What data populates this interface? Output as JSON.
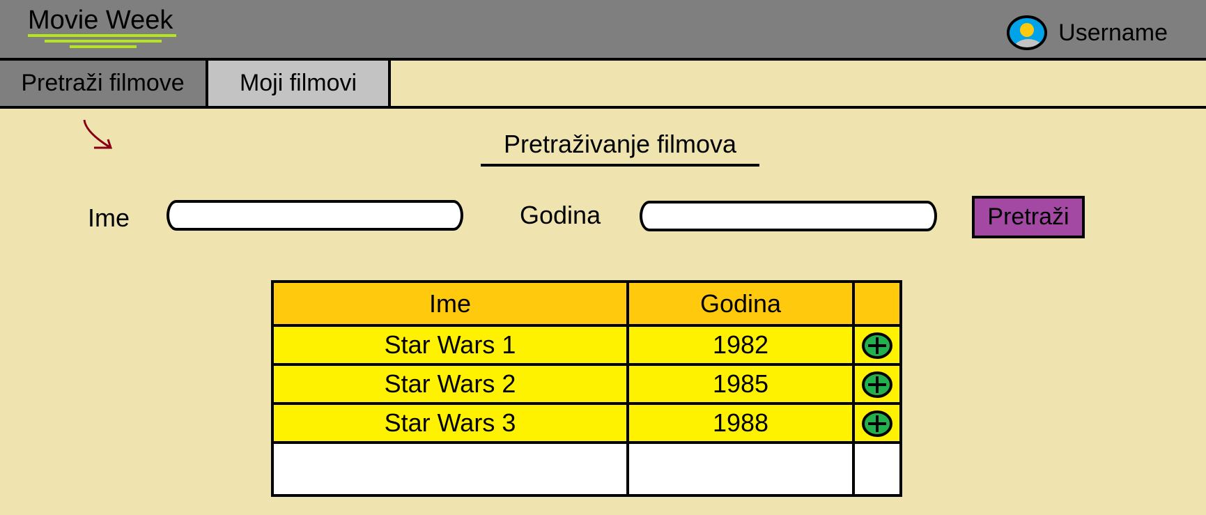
{
  "app": {
    "title": "Movie Week"
  },
  "user": {
    "name": "Username",
    "avatar_icon": "user-avatar-icon"
  },
  "tabs": [
    {
      "label": "Pretraži filmove",
      "active": true
    },
    {
      "label": "Moji filmovi",
      "active": false
    }
  ],
  "page": {
    "title": "Pretraživanje filmova"
  },
  "search": {
    "name_label": "Ime",
    "name_value": "",
    "year_label": "Godina",
    "year_value": "",
    "button_label": "Pretraži"
  },
  "table": {
    "headers": [
      "Ime",
      "Godina",
      ""
    ],
    "rows": [
      {
        "name": "Star Wars 1",
        "year": "1982",
        "action_icon": "add-icon"
      },
      {
        "name": "Star Wars 2",
        "year": "1985",
        "action_icon": "add-icon"
      },
      {
        "name": "Star Wars 3",
        "year": "1988",
        "action_icon": "add-icon"
      }
    ]
  },
  "colors": {
    "header_bg": "#7f7f7f",
    "page_bg": "#efe4b0",
    "table_header": "#ffc90e",
    "table_row": "#fff200",
    "search_button": "#a349a4",
    "add_icon": "#22b14c",
    "logo_underline": "#b5e61d"
  }
}
